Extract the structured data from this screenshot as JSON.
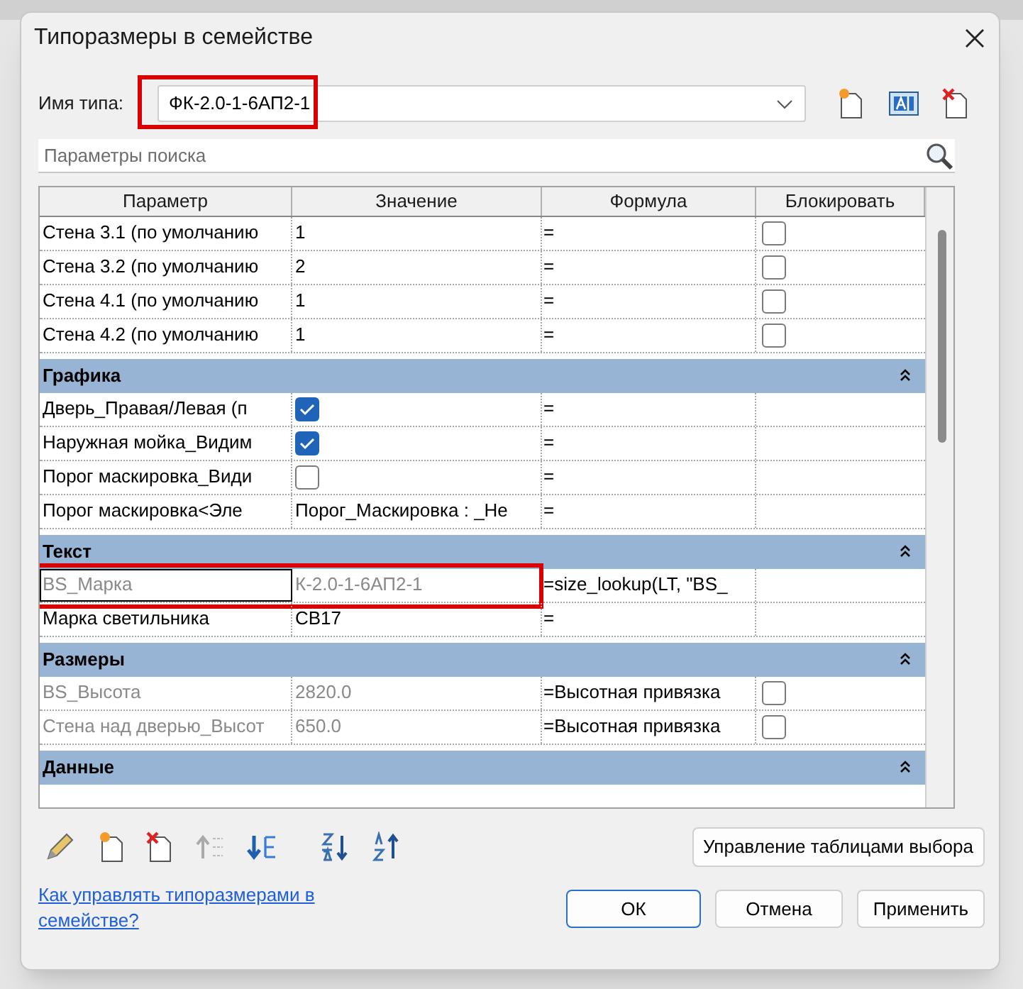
{
  "dialog": {
    "title": "Типоразмеры в семействе"
  },
  "type_name": {
    "label": "Имя типа:",
    "value": "ФК-2.0-1-6АП2-1",
    "highlighted": true
  },
  "search": {
    "placeholder": "Параметры поиска"
  },
  "table": {
    "columns": [
      "Параметр",
      "Значение",
      "Формула",
      "Блокировать"
    ],
    "rows": [
      {
        "kind": "param",
        "name": "Стена 3.1 (по умолчанию",
        "value": "1",
        "formula": "=",
        "lock": false,
        "greyed": false,
        "highlighted": false
      },
      {
        "kind": "param",
        "name": "Стена 3.2 (по умолчанию",
        "value": "2",
        "formula": "=",
        "lock": false,
        "greyed": false,
        "highlighted": false
      },
      {
        "kind": "param",
        "name": "Стена 4.1 (по умолчанию",
        "value": "1",
        "formula": "=",
        "lock": false,
        "greyed": false,
        "highlighted": false
      },
      {
        "kind": "param",
        "name": "Стена 4.2 (по умолчанию",
        "value": "1",
        "formula": "=",
        "lock": false,
        "greyed": false,
        "highlighted": false
      },
      {
        "kind": "group",
        "name": "Графика"
      },
      {
        "kind": "param",
        "name": "Дверь_Правая/Левая (п",
        "checked": true,
        "formula": "=",
        "greyed": false,
        "highlighted": false
      },
      {
        "kind": "param",
        "name": "Наружная мойка_Видим",
        "checked": true,
        "formula": "=",
        "greyed": false,
        "highlighted": false
      },
      {
        "kind": "param",
        "name": "Порог маскировка_Види",
        "checked": false,
        "formula": "=",
        "greyed": false,
        "highlighted": false
      },
      {
        "kind": "param",
        "name": "Порог маскировка<Эле",
        "value": "Порог_Маскировка : _Не",
        "formula": "=",
        "greyed": false,
        "highlighted": false
      },
      {
        "kind": "group",
        "name": "Текст"
      },
      {
        "kind": "param",
        "name": "BS_Марка",
        "value": "К-2.0-1-6АП2-1",
        "formula": "=size_lookup(LT, \"BS_",
        "greyed": true,
        "highlighted": true
      },
      {
        "kind": "param",
        "name": "Марка светильника",
        "value": "СВ17",
        "formula": "=",
        "greyed": false,
        "highlighted": false
      },
      {
        "kind": "group",
        "name": "Размеры"
      },
      {
        "kind": "param",
        "name": "BS_Высота",
        "value": "2820.0",
        "formula": "=Высотная привязка",
        "lock": false,
        "greyed": true,
        "highlighted": false
      },
      {
        "kind": "param",
        "name": "Стена над дверью_Высот",
        "value": "650.0",
        "formula": "=Высотная привязка",
        "lock": false,
        "greyed": true,
        "highlighted": false
      },
      {
        "kind": "group",
        "name": "Данные"
      }
    ]
  },
  "manage_button": "Управление таблицами выбора",
  "help_link": "Как управлять типоразмерами в семействе?",
  "buttons": [
    {
      "label": "ОК",
      "default": true
    },
    {
      "label": "Отмена",
      "default": false
    },
    {
      "label": "Применить",
      "default": false
    }
  ]
}
